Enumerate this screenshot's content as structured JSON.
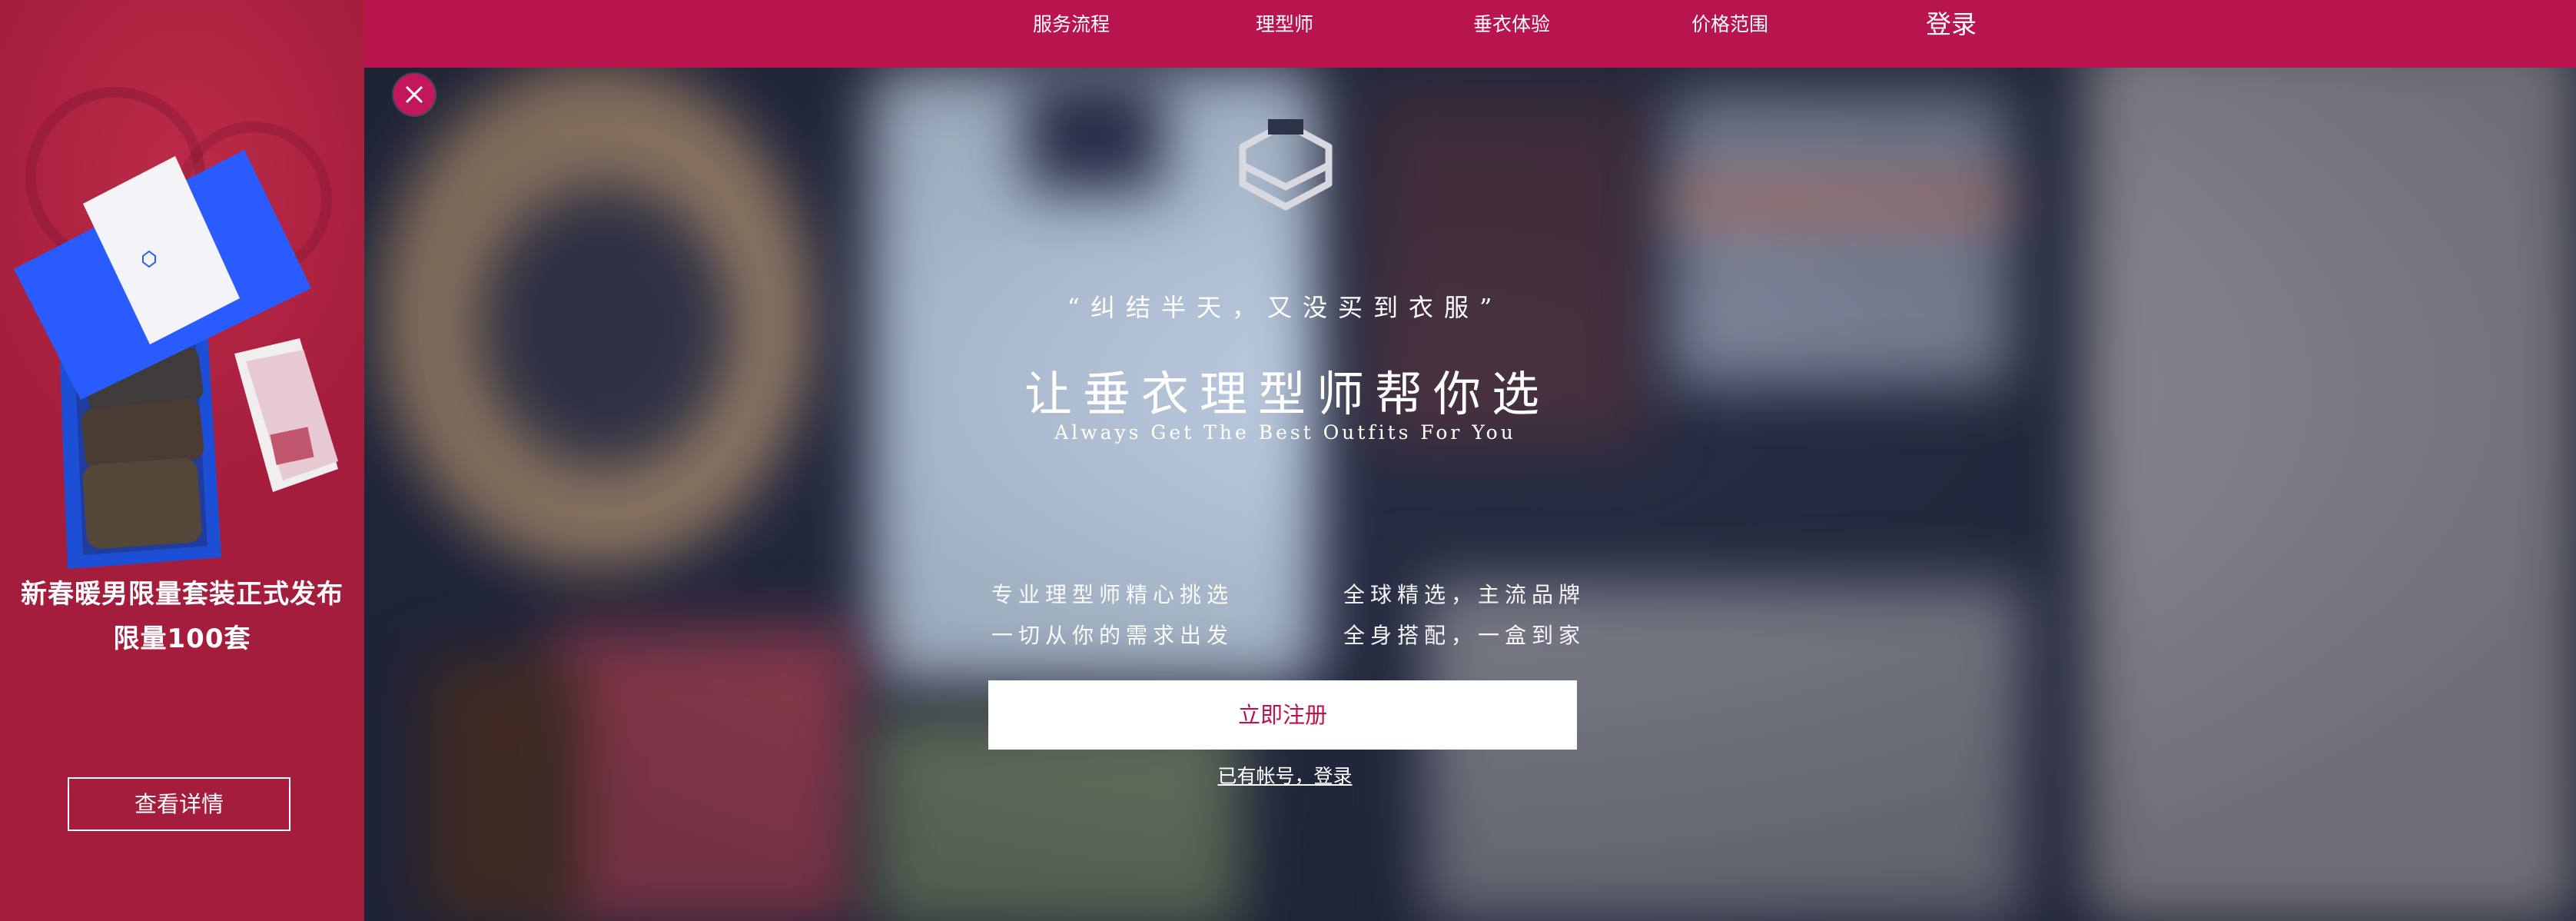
{
  "nav": {
    "items": [
      {
        "label": "服务流程"
      },
      {
        "label": "理型师"
      },
      {
        "label": "垂衣体验"
      },
      {
        "label": "价格范围"
      }
    ],
    "login_label": "登录"
  },
  "promo": {
    "title_line1": "新春暖男限量套装正式发布",
    "title_line2": "限量100套",
    "button_label": "查看详情",
    "background_color": "#a51d3c"
  },
  "close_icon": "close-icon",
  "hero": {
    "logo_icon": "hexagon-box-logo-icon",
    "quote": "“纠结半天，又没买到衣服”",
    "headline": "让垂衣理型师帮你选",
    "subline": "Always Get The Best Outfits For You",
    "features": [
      "专业理型师精心挑选",
      "全球精选，主流品牌",
      "一切从你的需求出发",
      "全身搭配，一盒到家"
    ],
    "register_label": "立即注册",
    "login_link": "已有帐号，登录"
  },
  "colors": {
    "brand": "#b8154f",
    "accent_button_text": "#b8154f",
    "hero_overlay": "#2a2f47"
  }
}
